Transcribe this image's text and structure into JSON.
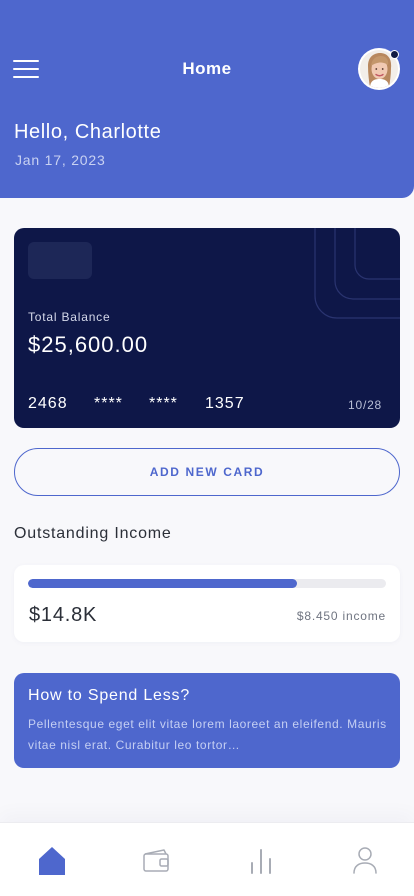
{
  "header": {
    "title": "Home",
    "greeting": "Hello, Charlotte",
    "date": "Jan 17, 2023",
    "menu_icon": "hamburger-menu-icon",
    "avatar_icon": "user-avatar"
  },
  "card": {
    "label": "Total Balance",
    "balance": "$25,600.00",
    "number_parts": [
      "2468",
      "****",
      "****",
      "1357"
    ],
    "expiry": "10/28"
  },
  "actions": {
    "add_card": "ADD NEW CARD"
  },
  "income": {
    "title": "Outstanding Income",
    "amount": "$14.8K",
    "label": "$8.450 income",
    "progress": 0.75
  },
  "tip": {
    "title": "How to Spend Less?",
    "body": "Pellentesque eget elit vitae lorem laoreet an eleifend. Mauris vitae nisl erat. Curabitur leo tortor…"
  },
  "nav": {
    "items": [
      {
        "icon": "home-icon",
        "active": true
      },
      {
        "icon": "wallet-icon",
        "active": false
      },
      {
        "icon": "bar-chart-icon",
        "active": false
      },
      {
        "icon": "profile-icon",
        "active": false
      }
    ]
  },
  "colors": {
    "primary": "#4e67cd",
    "card_background": "#0e1748",
    "page_background": "#f8f8fb",
    "inactive_icon": "#a8acb5"
  }
}
